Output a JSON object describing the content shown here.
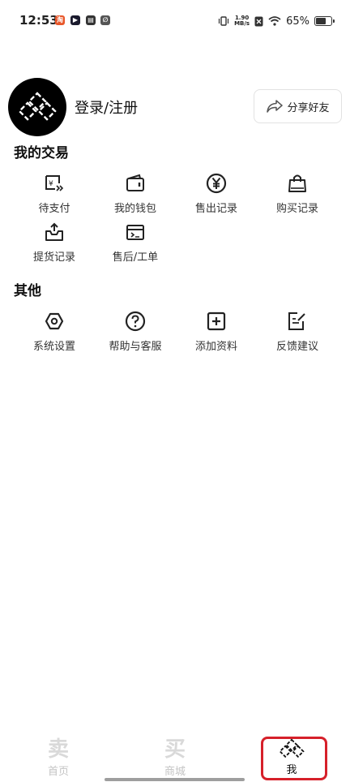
{
  "status_bar": {
    "time": "12:53",
    "net_speed_value": "1.90",
    "net_speed_unit": "MB/s",
    "battery": "65%"
  },
  "profile": {
    "login_label": "登录/注册",
    "share_label": "分享好友"
  },
  "trades": {
    "title": "我的交易",
    "items": [
      {
        "label": "待支付",
        "icon": "payment-pending-icon"
      },
      {
        "label": "我的钱包",
        "icon": "wallet-icon"
      },
      {
        "label": "售出记录",
        "icon": "yen-coin-icon"
      },
      {
        "label": "购买记录",
        "icon": "shopping-bag-icon"
      },
      {
        "label": "提货记录",
        "icon": "pickup-tray-icon"
      },
      {
        "label": "售后/工单",
        "icon": "ticket-icon"
      }
    ]
  },
  "other": {
    "title": "其他",
    "items": [
      {
        "label": "系统设置",
        "icon": "settings-hex-icon"
      },
      {
        "label": "帮助与客服",
        "icon": "help-icon"
      },
      {
        "label": "添加资料",
        "icon": "add-square-icon"
      },
      {
        "label": "反馈建议",
        "icon": "feedback-icon"
      }
    ]
  },
  "bottom_nav": {
    "home_glyph": "卖",
    "home_label": "首页",
    "mall_glyph": "买",
    "mall_label": "商城",
    "me_label": "我",
    "active": "我"
  },
  "colors": {
    "accent_frame": "#d6202a",
    "inactive_nav": "#c4c4c4",
    "avatar_bg": "#000000"
  }
}
